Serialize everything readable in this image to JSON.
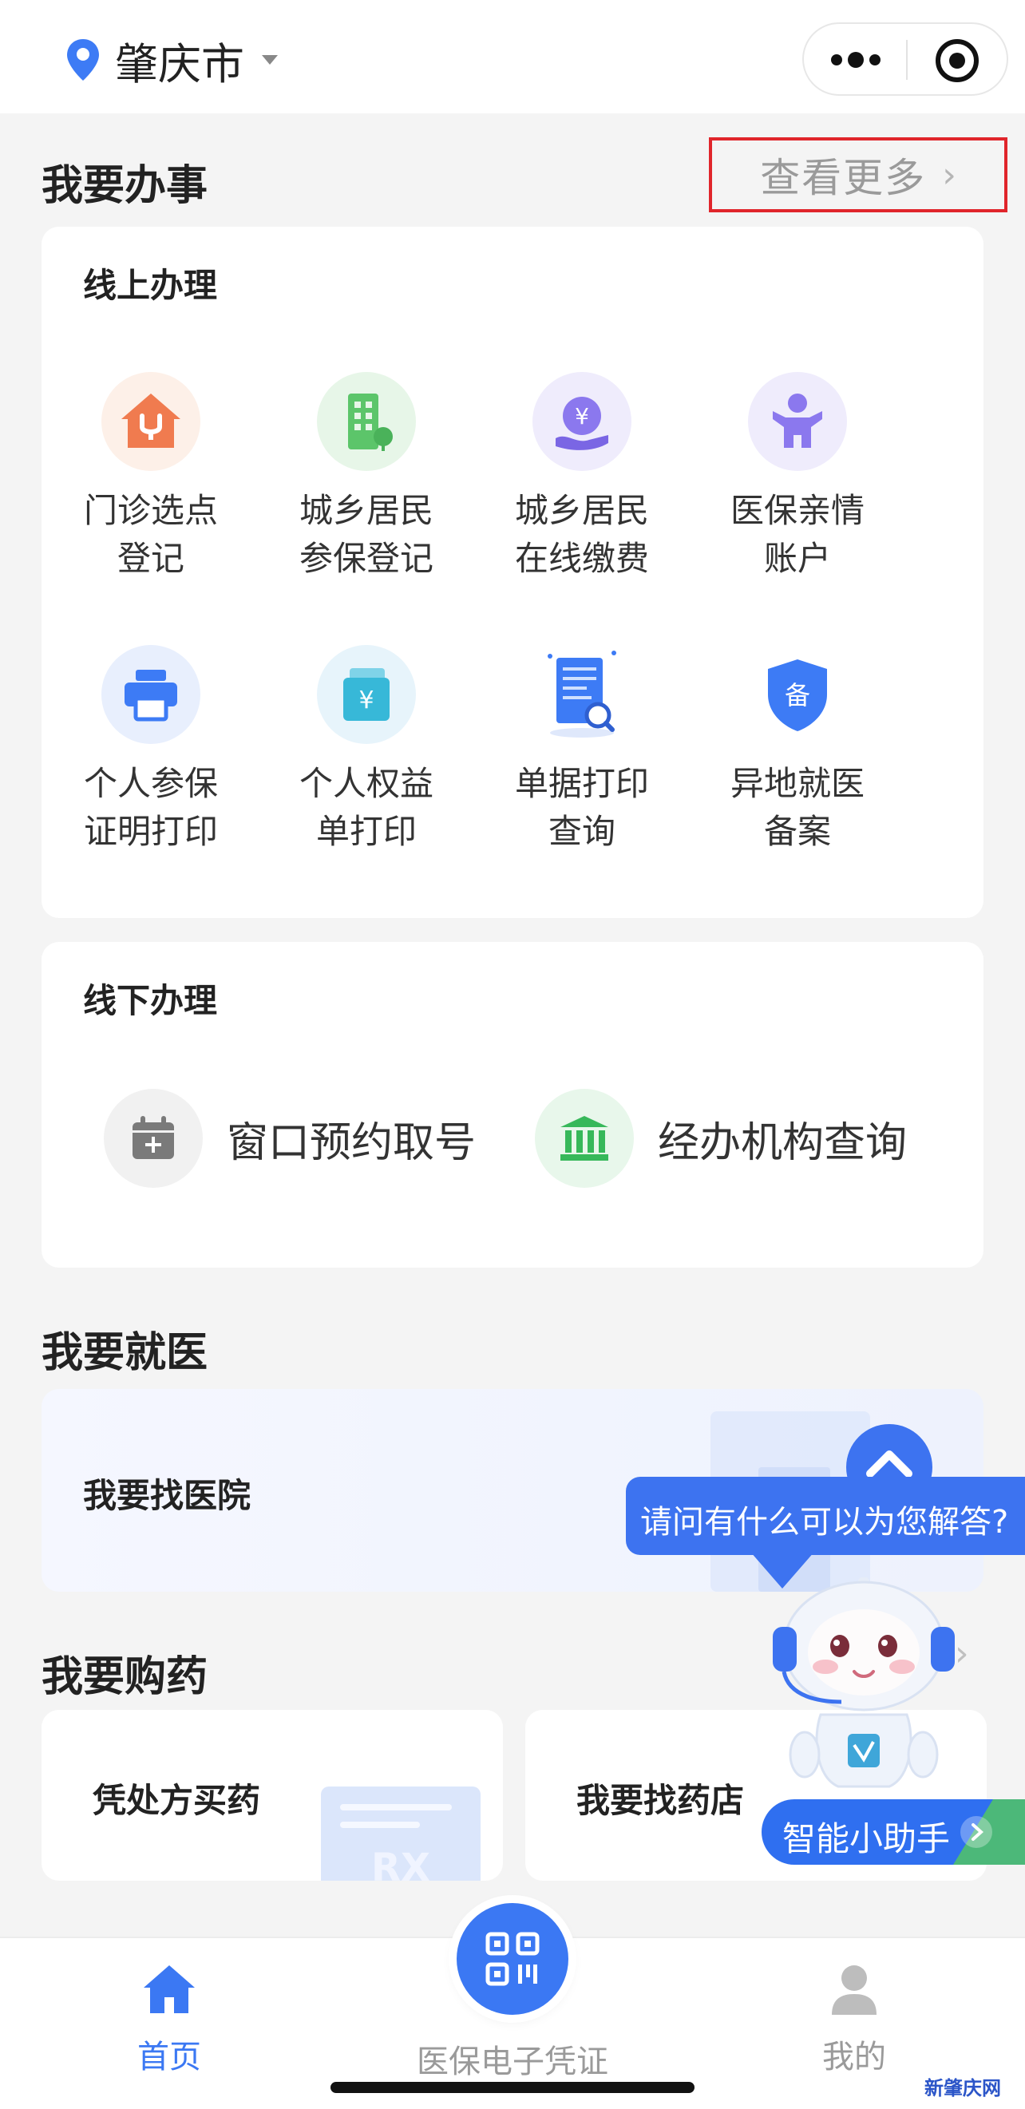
{
  "header": {
    "city": "肇庆市",
    "more_icon": "ellipsis-icon",
    "target_icon": "record-icon"
  },
  "work": {
    "title": "我要办事",
    "see_more": "查看更多",
    "online": {
      "title": "线上办理",
      "items": [
        {
          "line1": "门诊选点",
          "line2": "登记",
          "icon": "hospital-house-icon",
          "color": "#f07b4f"
        },
        {
          "line1": "城乡居民",
          "line2": "参保登记",
          "icon": "building-icon",
          "color": "#5cc56a"
        },
        {
          "line1": "城乡居民",
          "line2": "在线缴费",
          "icon": "yuan-hand-icon",
          "color": "#8b78ee"
        },
        {
          "line1": "医保亲情",
          "line2": "账户",
          "icon": "person-icon",
          "color": "#8b78ee"
        },
        {
          "line1": "个人参保",
          "line2": "证明打印",
          "icon": "printer-icon",
          "color": "#3d7bf5"
        },
        {
          "line1": "个人权益",
          "line2": "单打印",
          "icon": "wallet-icon",
          "color": "#37b8d8"
        },
        {
          "line1": "单据打印",
          "line2": "查询",
          "icon": "document-search-icon",
          "color": "#3d7bf5"
        },
        {
          "line1": "异地就医",
          "line2": "备案",
          "icon": "shield-icon",
          "color": "#3d7bf5"
        }
      ]
    },
    "offline": {
      "title": "线下办理",
      "items": [
        {
          "label": "窗口预约取号",
          "icon": "calendar-icon"
        },
        {
          "label": "经办机构查询",
          "icon": "institution-icon"
        }
      ]
    }
  },
  "medical": {
    "title": "我要就医",
    "find_hospital": "我要找医院"
  },
  "drugs": {
    "title": "我要购药",
    "prescription": "凭处方买药",
    "find_pharmacy": "我要找药店"
  },
  "assistant": {
    "bubble": "请问有什么可以为您解答?",
    "label": "智能小助手"
  },
  "tabbar": {
    "home": "首页",
    "voucher": "医保电子凭证",
    "mine": "我的"
  },
  "watermark": "新肇庆网"
}
